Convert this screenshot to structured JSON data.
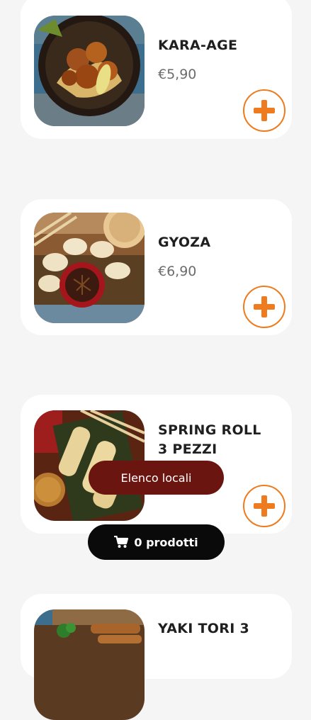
{
  "products": [
    {
      "name": "KARA-AGE",
      "price": "€5,90",
      "image": "karaage-food-photo",
      "add_icon": "plus-icon"
    },
    {
      "name": "GYOZA",
      "price": "€6,90",
      "image": "gyoza-food-photo",
      "add_icon": "plus-icon"
    },
    {
      "name_lines": [
        "SPRING ROLL",
        "3 PEZZI"
      ],
      "price": "",
      "image": "spring-roll-food-photo",
      "add_icon": "plus-icon"
    },
    {
      "name": "YAKI TORI 3",
      "image": "yakitori-food-photo"
    }
  ],
  "floating": {
    "locali_label": "Elenco locali",
    "cart_label": "0 prodotti",
    "cart_icon": "cart-icon"
  },
  "colors": {
    "accent_orange": "#ee7b1d",
    "locali_bg": "#6a1510",
    "cart_bg": "#0a0a0a",
    "card_bg": "#ffffff",
    "page_bg": "#f5f5f5"
  }
}
